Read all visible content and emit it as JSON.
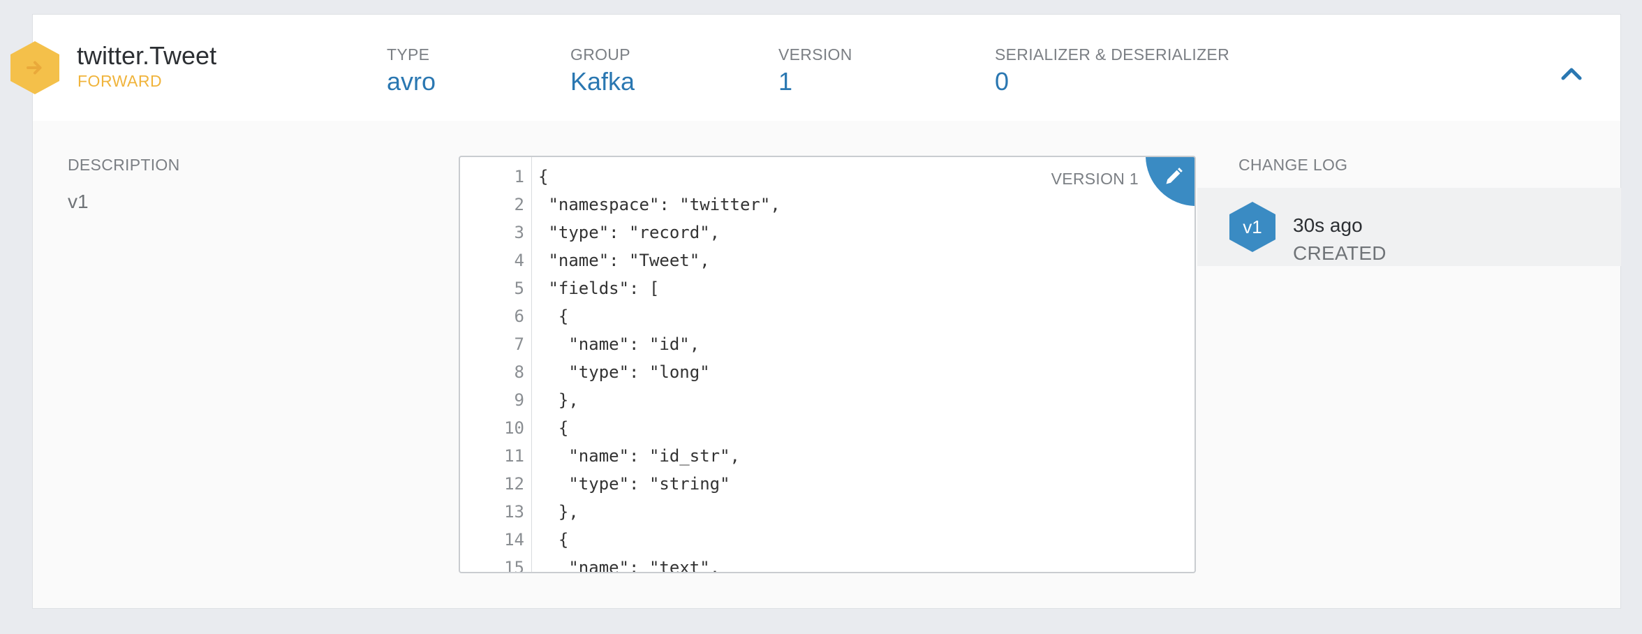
{
  "header": {
    "title": "twitter.Tweet",
    "subtitle": "FORWARD",
    "type_label": "TYPE",
    "type_value": "avro",
    "group_label": "GROUP",
    "group_value": "Kafka",
    "version_label": "VERSION",
    "version_value": "1",
    "serde_label": "SERIALIZER & DESERIALIZER",
    "serde_value": "0",
    "badge_icon": "arrow-right-icon",
    "collapse_icon": "chevron-up-icon"
  },
  "description": {
    "label": "DESCRIPTION",
    "value": "v1"
  },
  "editor": {
    "version_tag": "VERSION 1",
    "edit_icon": "pencil-icon",
    "lines": [
      {
        "no": "1",
        "text": "{"
      },
      {
        "no": "2",
        "text": " \"namespace\": \"twitter\","
      },
      {
        "no": "3",
        "text": " \"type\": \"record\","
      },
      {
        "no": "4",
        "text": " \"name\": \"Tweet\","
      },
      {
        "no": "5",
        "text": " \"fields\": ["
      },
      {
        "no": "6",
        "text": "  {"
      },
      {
        "no": "7",
        "text": "   \"name\": \"id\","
      },
      {
        "no": "8",
        "text": "   \"type\": \"long\""
      },
      {
        "no": "9",
        "text": "  },"
      },
      {
        "no": "10",
        "text": "  {"
      },
      {
        "no": "11",
        "text": "   \"name\": \"id_str\","
      },
      {
        "no": "12",
        "text": "   \"type\": \"string\""
      },
      {
        "no": "13",
        "text": "  },"
      },
      {
        "no": "14",
        "text": "  {"
      },
      {
        "no": "15",
        "text": "   \"name\": \"text\","
      }
    ]
  },
  "changelog": {
    "label": "CHANGE LOG",
    "entries": [
      {
        "badge": "v1",
        "time": "30s ago",
        "action": "CREATED"
      }
    ]
  },
  "colors": {
    "accent": "#2a77b1",
    "badge": "#f4c04a",
    "forward": "#f0b43c",
    "version_hex": "#3a8bc3"
  }
}
